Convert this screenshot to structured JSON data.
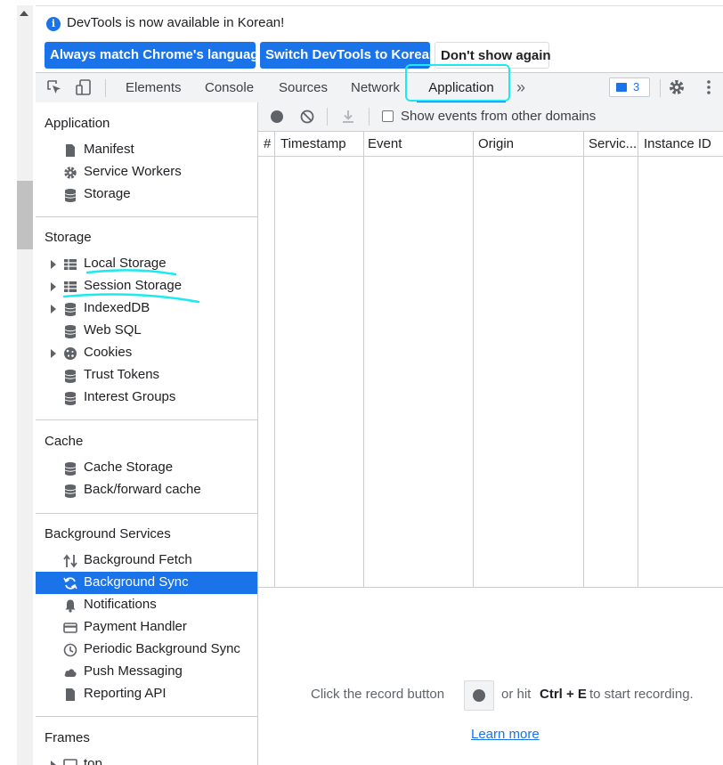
{
  "infobar": {
    "message": "DevTools is now available in Korean!",
    "btn_match": "Always match Chrome's language",
    "btn_switch": "Switch DevTools to Korean",
    "btn_dismiss": "Don't show again"
  },
  "tabs": {
    "elements": "Elements",
    "console": "Console",
    "sources": "Sources",
    "network": "Network",
    "application": "Application",
    "more": "»",
    "issues_count": "3"
  },
  "sidebar": {
    "application": {
      "header": "Application",
      "items": [
        "Manifest",
        "Service Workers",
        "Storage"
      ]
    },
    "storage": {
      "header": "Storage",
      "items": [
        "Local Storage",
        "Session Storage",
        "IndexedDB",
        "Web SQL",
        "Cookies",
        "Trust Tokens",
        "Interest Groups"
      ]
    },
    "cache": {
      "header": "Cache",
      "items": [
        "Cache Storage",
        "Back/forward cache"
      ]
    },
    "background": {
      "header": "Background Services",
      "items": [
        "Background Fetch",
        "Background Sync",
        "Notifications",
        "Payment Handler",
        "Periodic Background Sync",
        "Push Messaging",
        "Reporting API"
      ]
    },
    "frames": {
      "header": "Frames",
      "items": [
        "top"
      ]
    }
  },
  "main": {
    "show_other_domains": "Show events from other domains",
    "columns": [
      "#",
      "Timestamp",
      "Event",
      "Origin",
      "Servic...",
      "Instance ID"
    ],
    "empty_prefix": "Click the record button",
    "empty_mid": "or hit",
    "empty_shortcut": "Ctrl + E",
    "empty_suffix": "to start recording.",
    "learn_more": "Learn more"
  },
  "colors": {
    "accent": "#1a73e8",
    "annotation": "#1de9f0",
    "selected_bg": "#1a73e8"
  }
}
